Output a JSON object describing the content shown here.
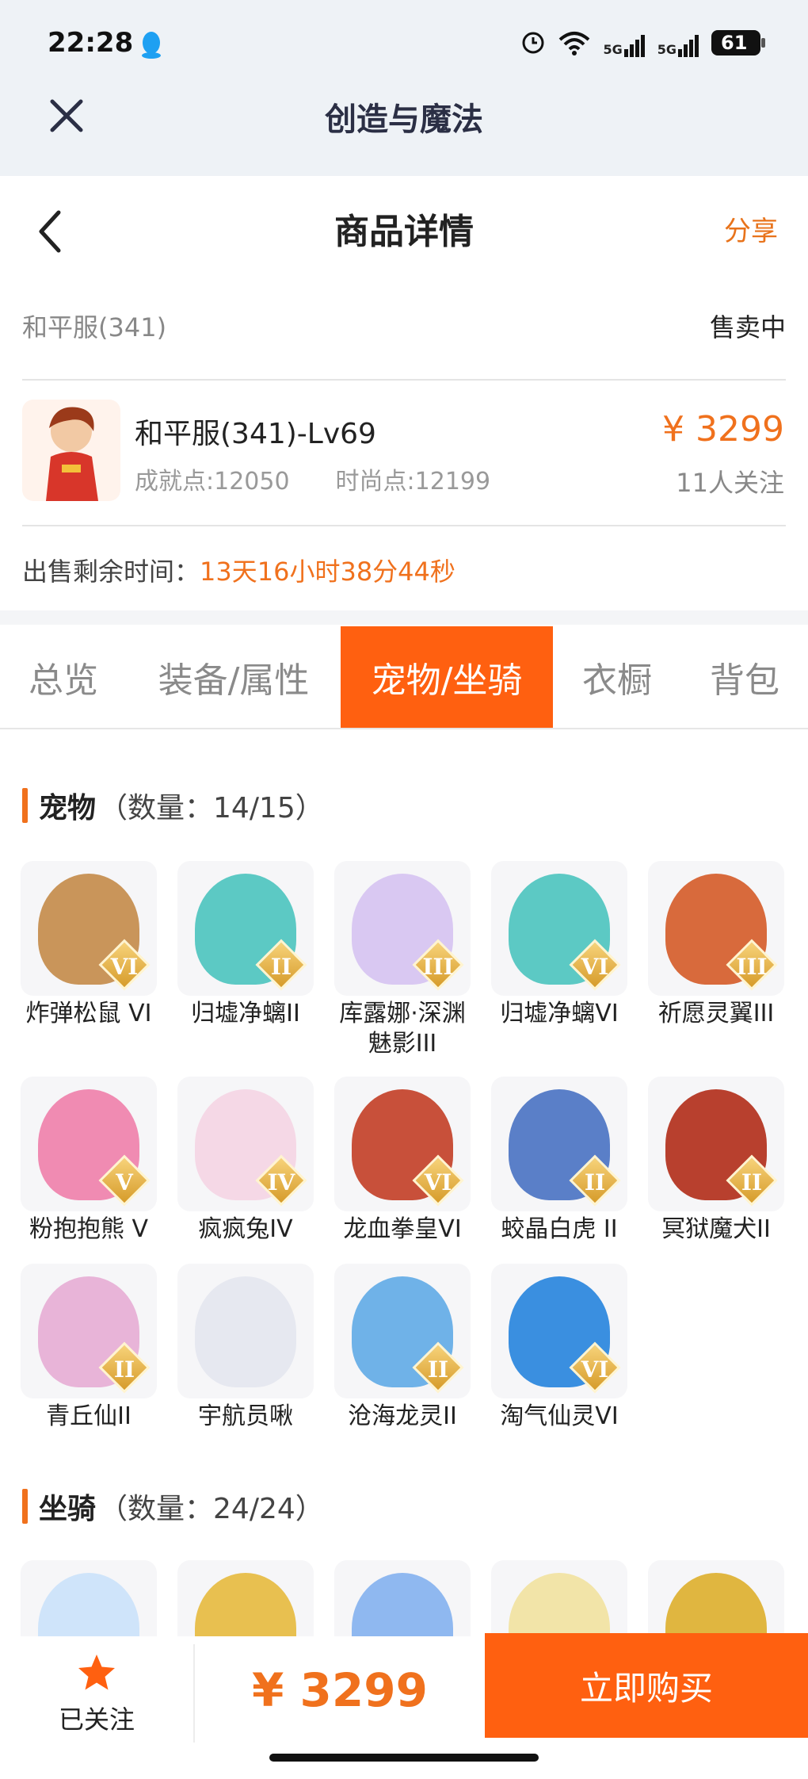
{
  "status_bar": {
    "time": "22:28",
    "battery": "61",
    "network1": "5G",
    "network2": "5G"
  },
  "app_bar": {
    "title": "创造与魔法"
  },
  "nav": {
    "title": "商品详情",
    "share": "分享"
  },
  "server": {
    "name": "和平服(341)",
    "status": "售卖中"
  },
  "product": {
    "name": "和平服(341)-Lv69",
    "achievement": "成就点:12050",
    "fashion": "时尚点:12199",
    "price": "¥ 3299",
    "followers": "11人关注"
  },
  "remaining": {
    "label": "出售剩余时间：",
    "value": "13天16小时38分44秒"
  },
  "tabs": [
    {
      "label": "总览",
      "active": false
    },
    {
      "label": "装备/属性",
      "active": false
    },
    {
      "label": "宠物/坐骑",
      "active": true
    },
    {
      "label": "衣橱",
      "active": false
    },
    {
      "label": "背包",
      "active": false
    }
  ],
  "pets_section": {
    "title": "宠物",
    "count": "（数量：14/15）"
  },
  "pets": [
    {
      "name": "炸弹松鼠 VI",
      "badge": "VI",
      "color": "#c9955a"
    },
    {
      "name": "归墟净螭II",
      "badge": "II",
      "color": "#5cc9c4"
    },
    {
      "name": "库露娜·深渊魅影III",
      "badge": "III",
      "color": "#d9c8f2"
    },
    {
      "name": "归墟净螭VI",
      "badge": "VI",
      "color": "#5cc9c4"
    },
    {
      "name": "祈愿灵翼III",
      "badge": "III",
      "color": "#d86a3c"
    },
    {
      "name": "粉抱抱熊 V",
      "badge": "V",
      "color": "#f08bb2"
    },
    {
      "name": "疯疯兔IV",
      "badge": "IV",
      "color": "#f5d8e6"
    },
    {
      "name": "龙血拳皇VI",
      "badge": "VI",
      "color": "#c8503a"
    },
    {
      "name": "蛟晶白虎 II",
      "badge": "II",
      "color": "#5a7fc8"
    },
    {
      "name": "冥狱魔犬II",
      "badge": "II",
      "color": "#b8402e"
    },
    {
      "name": "青丘仙II",
      "badge": "II",
      "color": "#e8b4d8"
    },
    {
      "name": "宇航员啾",
      "badge": "",
      "color": "#e6e8f0"
    },
    {
      "name": "沧海龙灵II",
      "badge": "II",
      "color": "#6fb2e8"
    },
    {
      "name": "淘气仙灵VI",
      "badge": "VI",
      "color": "#3a8fe0"
    }
  ],
  "mounts_section": {
    "title": "坐骑",
    "count": "（数量：24/24）"
  },
  "mounts": [
    {
      "color": "#cfe4fa"
    },
    {
      "color": "#e8c050"
    },
    {
      "color": "#8fb8f0"
    },
    {
      "color": "#f2e4a8"
    },
    {
      "color": "#e0b640"
    }
  ],
  "bottom_bar": {
    "follow_label": "已关注",
    "price": "¥ 3299",
    "buy_label": "立即购买"
  }
}
